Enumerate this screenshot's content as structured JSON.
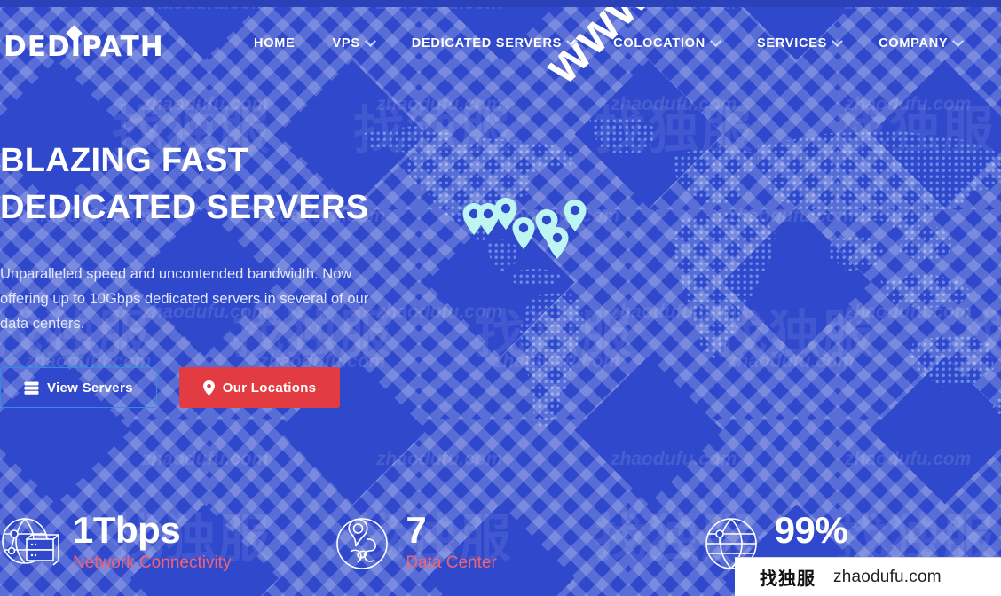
{
  "site": {
    "logo_text": "DEDIPATH",
    "background_color": "#3049cc",
    "accent_red": "#e23c42",
    "accent_pink": "#ef6474",
    "outline_blue": "#2f8ee0"
  },
  "nav": {
    "items": [
      {
        "label": "HOME",
        "has_dropdown": false,
        "icon": ""
      },
      {
        "label": "VPS",
        "has_dropdown": true,
        "icon": "chevron-down-icon"
      },
      {
        "label": "DEDICATED SERVERS",
        "has_dropdown": true,
        "icon": "chevron-down-icon"
      },
      {
        "label": "COLOCATION",
        "has_dropdown": true,
        "icon": "chevron-down-icon"
      },
      {
        "label": "SERVICES",
        "has_dropdown": true,
        "icon": "chevron-down-icon"
      },
      {
        "label": "COMPANY",
        "has_dropdown": true,
        "icon": "chevron-down-icon"
      }
    ]
  },
  "hero": {
    "headline_line1": "BLAZING FAST",
    "headline_line2": "DEDICATED SERVERS",
    "paragraph": "Unparalleled speed and uncontended bandwidth. Now offering up to 10Gbps dedicated servers in several of our data centers.",
    "buttons": [
      {
        "label": "View Servers",
        "icon": "server-icon",
        "style": "outline"
      },
      {
        "label": "Our Locations",
        "icon": "map-pin-icon",
        "style": "solid-red"
      }
    ]
  },
  "stats": [
    {
      "value": "1Tbps",
      "label": "Network Connectivity",
      "icon": "globe-server-icon"
    },
    {
      "value": "7",
      "label": "Data Center",
      "icon": "globe-pin-icon"
    },
    {
      "value": "99%",
      "label": "",
      "icon": "globe-icon"
    }
  ],
  "watermarks": {
    "big_diagonal": "www.veidc.com",
    "tiled_latin": "zhaodufu.com",
    "tiled_cjk": "找独服"
  },
  "overlay_badge": {
    "cjk": "找独服",
    "url": "zhaodufu.com"
  },
  "map": {
    "pin_count": 7,
    "pin_color": "#bdf5f2"
  }
}
